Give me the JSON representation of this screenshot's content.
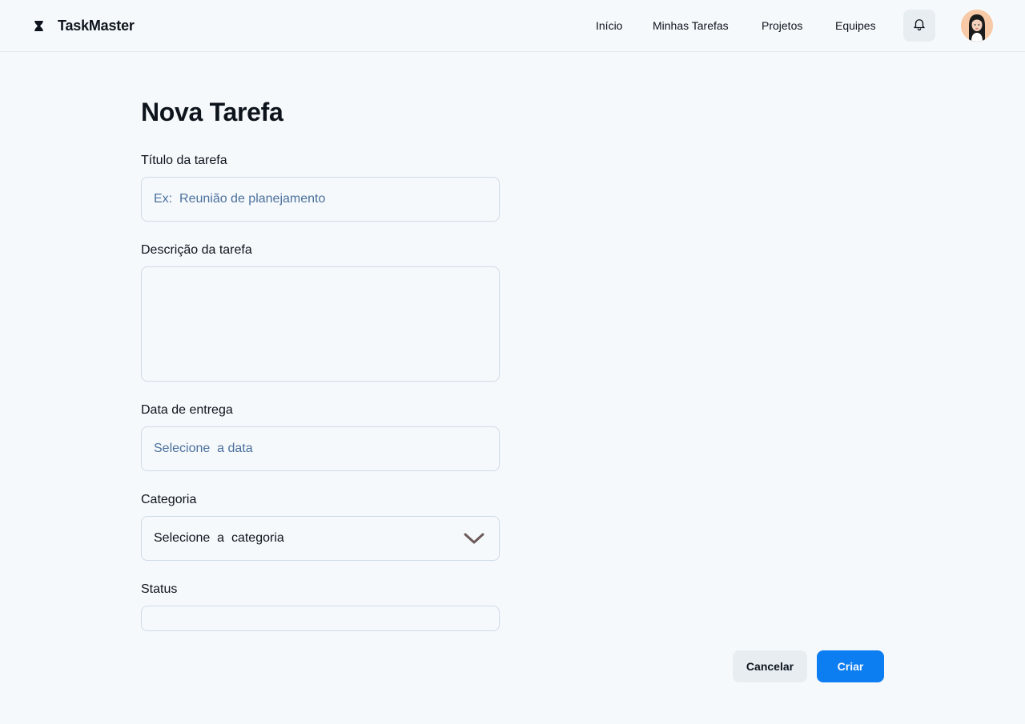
{
  "app": {
    "name": "TaskMaster",
    "logo_icon": "hourglass-logo-icon"
  },
  "nav": {
    "items": [
      {
        "label": "Início"
      },
      {
        "label": "Minhas Tarefas"
      },
      {
        "label": "Projetos"
      },
      {
        "label": "Equipes"
      }
    ],
    "notifications_icon": "bell-icon",
    "avatar_icon": "user-avatar"
  },
  "form": {
    "title": "Nova Tarefa",
    "title_field": {
      "label": "Título da tarefa",
      "placeholder": "Ex:  Reunião de planejamento",
      "value": ""
    },
    "description_field": {
      "label": "Descrição da tarefa",
      "value": ""
    },
    "date_field": {
      "label": "Data de entrega",
      "placeholder": "Selecione  a data",
      "value": ""
    },
    "category_field": {
      "label": "Categoria",
      "selected": "Selecione  a  categoria",
      "icon": "chevron-down-icon"
    },
    "status_field": {
      "label": "Status",
      "value": ""
    }
  },
  "actions": {
    "cancel_label": "Cancelar",
    "create_label": "Criar"
  },
  "colors": {
    "background": "#f6f9fc",
    "accent": "#0d7df2",
    "border": "#cfdbe8",
    "placeholder": "#4a709c",
    "secondary_button": "#e8edf2"
  }
}
